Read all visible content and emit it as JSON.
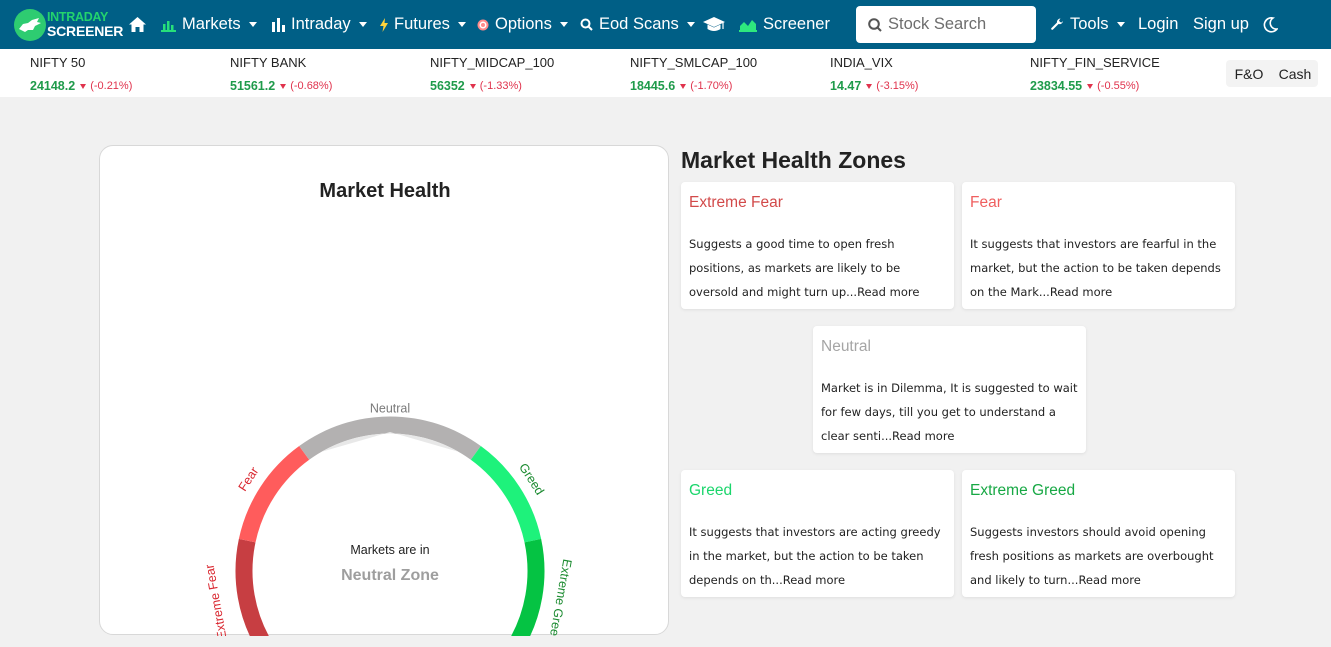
{
  "brand": {
    "line1": "INTRADAY",
    "line2": "SCREENER"
  },
  "nav": {
    "home_icon": "home-icon",
    "items": [
      {
        "label": "Markets",
        "icon": "bar-chart-icon",
        "dropdown": true
      },
      {
        "label": "Intraday",
        "icon": "bar-chart-icon",
        "dropdown": true
      },
      {
        "label": "Futures",
        "icon": "bolt-icon",
        "dropdown": true
      },
      {
        "label": "Options",
        "icon": "target-icon",
        "dropdown": true
      },
      {
        "label": "Eod Scans",
        "icon": "search-icon",
        "dropdown": true
      },
      {
        "label": "",
        "icon": "graduation-cap-icon",
        "dropdown": false
      },
      {
        "label": "Screener",
        "icon": "area-chart-icon",
        "dropdown": false
      }
    ],
    "search_placeholder": "Stock Search",
    "tools_label": "Tools",
    "login_label": "Login",
    "signup_label": "Sign up",
    "theme_icon": "moon-icon"
  },
  "ticker": [
    {
      "name": "NIFTY 50",
      "value": "24148.2",
      "change": "(-0.21%)"
    },
    {
      "name": "NIFTY BANK",
      "value": "51561.2",
      "change": "(-0.68%)"
    },
    {
      "name": "NIFTY_MIDCAP_100",
      "value": "56352",
      "change": "(-1.33%)"
    },
    {
      "name": "NIFTY_SMLCAP_100",
      "value": "18445.6",
      "change": "(-1.70%)"
    },
    {
      "name": "INDIA_VIX",
      "value": "14.47",
      "change": "(-3.15%)"
    },
    {
      "name": "NIFTY_FIN_SERVICE",
      "value": "23834.55",
      "change": "(-0.55%)"
    }
  ],
  "segment_toggle": {
    "fno": "F&O",
    "cash": "Cash"
  },
  "gauge": {
    "title": "Market Health",
    "zones": [
      {
        "label": "Extreme Fear",
        "color": "#c73e42",
        "text_color": "#d9262f"
      },
      {
        "label": "Fear",
        "color": "#ff5c5c",
        "text_color": "#d9262f"
      },
      {
        "label": "Neutral",
        "color": "#b3b1b1",
        "text_color": "#7a7a7a"
      },
      {
        "label": "Greed",
        "color": "#1ef27b",
        "text_color": "#1a8a2f"
      },
      {
        "label": "Extreme Greed",
        "color": "#05c343",
        "text_color": "#1a8a2f"
      }
    ],
    "pointer_color": "#e8e8e8",
    "markets_in_label": "Markets are in",
    "current_zone": "Neutral Zone"
  },
  "zones_section": {
    "heading": "Market Health Zones",
    "cards": [
      {
        "title": "Extreme Fear",
        "title_color": "#d24a4a",
        "desc": "Suggests a good time to open fresh positions, as markets are likely to be oversold and might turn up...Read more"
      },
      {
        "title": "Fear",
        "title_color": "#ef5f5f",
        "desc": "It suggests that investors are fearful in the market, but the action to be taken depends on the Mark...Read more"
      },
      {
        "title": "Neutral",
        "title_color": "#a5a5a5",
        "desc": "Market is in Dilemma, It is suggested to wait for few days, till you get to understand a clear senti...Read more"
      },
      {
        "title": "Greed",
        "title_color": "#1bd66c",
        "desc": "It suggests that investors are acting greedy in the market, but the action to be taken depends on th...Read more"
      },
      {
        "title": "Extreme Greed",
        "title_color": "#17a844",
        "desc": "Suggests investors should avoid opening fresh positions as markets are overbought and likely to turn...Read more"
      }
    ]
  }
}
